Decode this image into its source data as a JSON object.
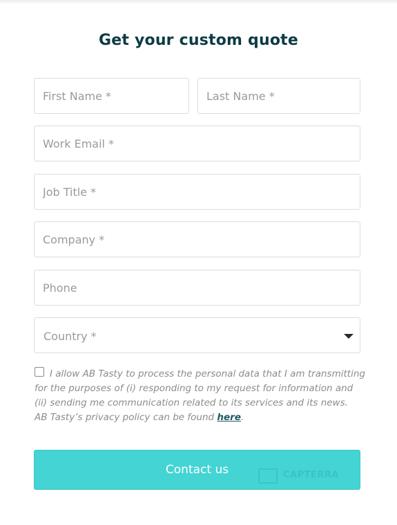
{
  "form": {
    "title": "Get your custom quote",
    "fields": {
      "first_name": "First Name *",
      "last_name": "Last Name *",
      "work_email": "Work Email *",
      "job_title": "Job Title *",
      "company": "Company *",
      "phone": "Phone",
      "country": "Country *"
    },
    "consent": {
      "text_1": "I allow AB Tasty to process the personal data that I am transmitting for the purposes of (i) responding to my request for information and (ii) sending me communication related to its services and its news.",
      "text_2": "AB Tasty’s privacy policy can be found ",
      "link": "here",
      "text_end": "."
    },
    "submit_label": "Contact us"
  },
  "watermark": {
    "text": "CAPTERRA"
  },
  "colors": {
    "title": "#0d3b45",
    "button": "#44d4d4",
    "link": "#1e5a64"
  }
}
